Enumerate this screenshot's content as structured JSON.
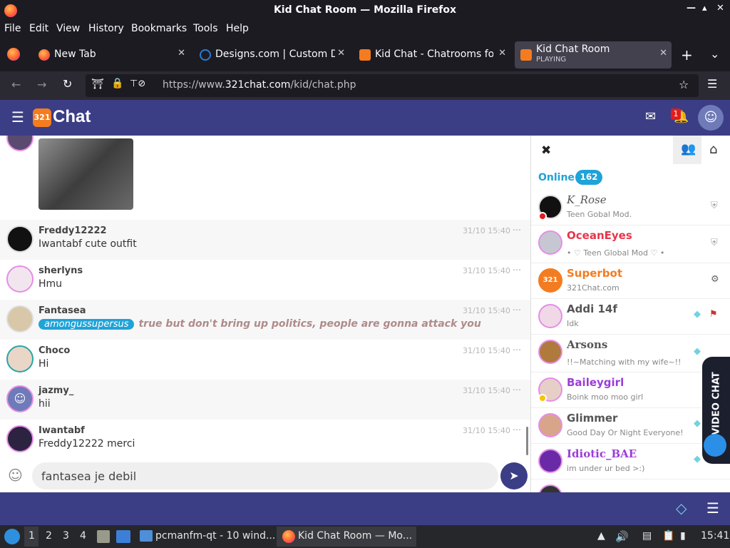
{
  "window": {
    "title": "Kid Chat Room — Mozilla Firefox"
  },
  "menu": {
    "file": "File",
    "edit": "Edit",
    "view": "View",
    "history": "History",
    "bookmarks": "Bookmarks",
    "tools": "Tools",
    "help": "Help"
  },
  "tabs": [
    {
      "label": "New Tab"
    },
    {
      "label": "Designs.com | Custom D"
    },
    {
      "label": "Kid Chat - Chatrooms for"
    },
    {
      "label": "Kid Chat Room",
      "sub": "PLAYING"
    }
  ],
  "url": {
    "prefix": "https://www.",
    "domain": "321chat.com",
    "path": "/kid/chat.php"
  },
  "site": {
    "logo_badge": "321",
    "logo_text": "Chat",
    "notification_count": "1"
  },
  "messages": [
    {
      "user": "Freddy12222",
      "text": "Iwantabf cute outfit",
      "time": "31/10 15:40"
    },
    {
      "user": "sherlyns",
      "text": "Hmu",
      "time": "31/10 15:40"
    },
    {
      "user": "Fantasea",
      "mention": "amongussupersus",
      "text": "true but don't bring up politics, people are gonna attack you",
      "time": "31/10 15:40"
    },
    {
      "user": "Choco",
      "text": "Hi",
      "time": "31/10 15:40"
    },
    {
      "user": "jazmy_",
      "text": "hii",
      "time": "31/10 15:40"
    },
    {
      "user": "Iwantabf",
      "text": "Freddy12222 merci",
      "time": "31/10 15:40"
    }
  ],
  "more_glyph": "⋯",
  "input": {
    "value": "fantasea je debil"
  },
  "sidebar": {
    "online_label": "Online",
    "online_count": "162",
    "video_chat_label": "VIDEO CHAT",
    "users": [
      {
        "name": "K_Rose",
        "status": "Teen Gobal Mod.",
        "color": "#555555"
      },
      {
        "name": "OceanEyes",
        "status": "• ♡ Teen Global Mod ♡ •",
        "color": "#e8354a"
      },
      {
        "name": "Superbot",
        "status": "321Chat.com",
        "color": "#f47c20"
      },
      {
        "name": "Addi 14f",
        "status": "Idk",
        "color": "#555555"
      },
      {
        "name": "Arsons",
        "status": "!!~Matching with my wife~!!",
        "color": "#555555"
      },
      {
        "name": "Baileygirl",
        "status": "Boink moo moo girl",
        "color": "#9b3dd6"
      },
      {
        "name": "Glimmer",
        "status": "Good Day Or Night Everyone!",
        "color": "#555555"
      },
      {
        "name": "Idiotic_BAE",
        "status": "im under ur bed >:)",
        "color": "#9b3dd6"
      }
    ]
  },
  "taskbar": {
    "ws1": "1",
    "ws2": "2",
    "ws3": "3",
    "ws4": "4",
    "file_manager": "pcmanfm-qt - 10 wind...",
    "firefox": "Kid Chat Room — Mo...",
    "clock": "15:41"
  }
}
